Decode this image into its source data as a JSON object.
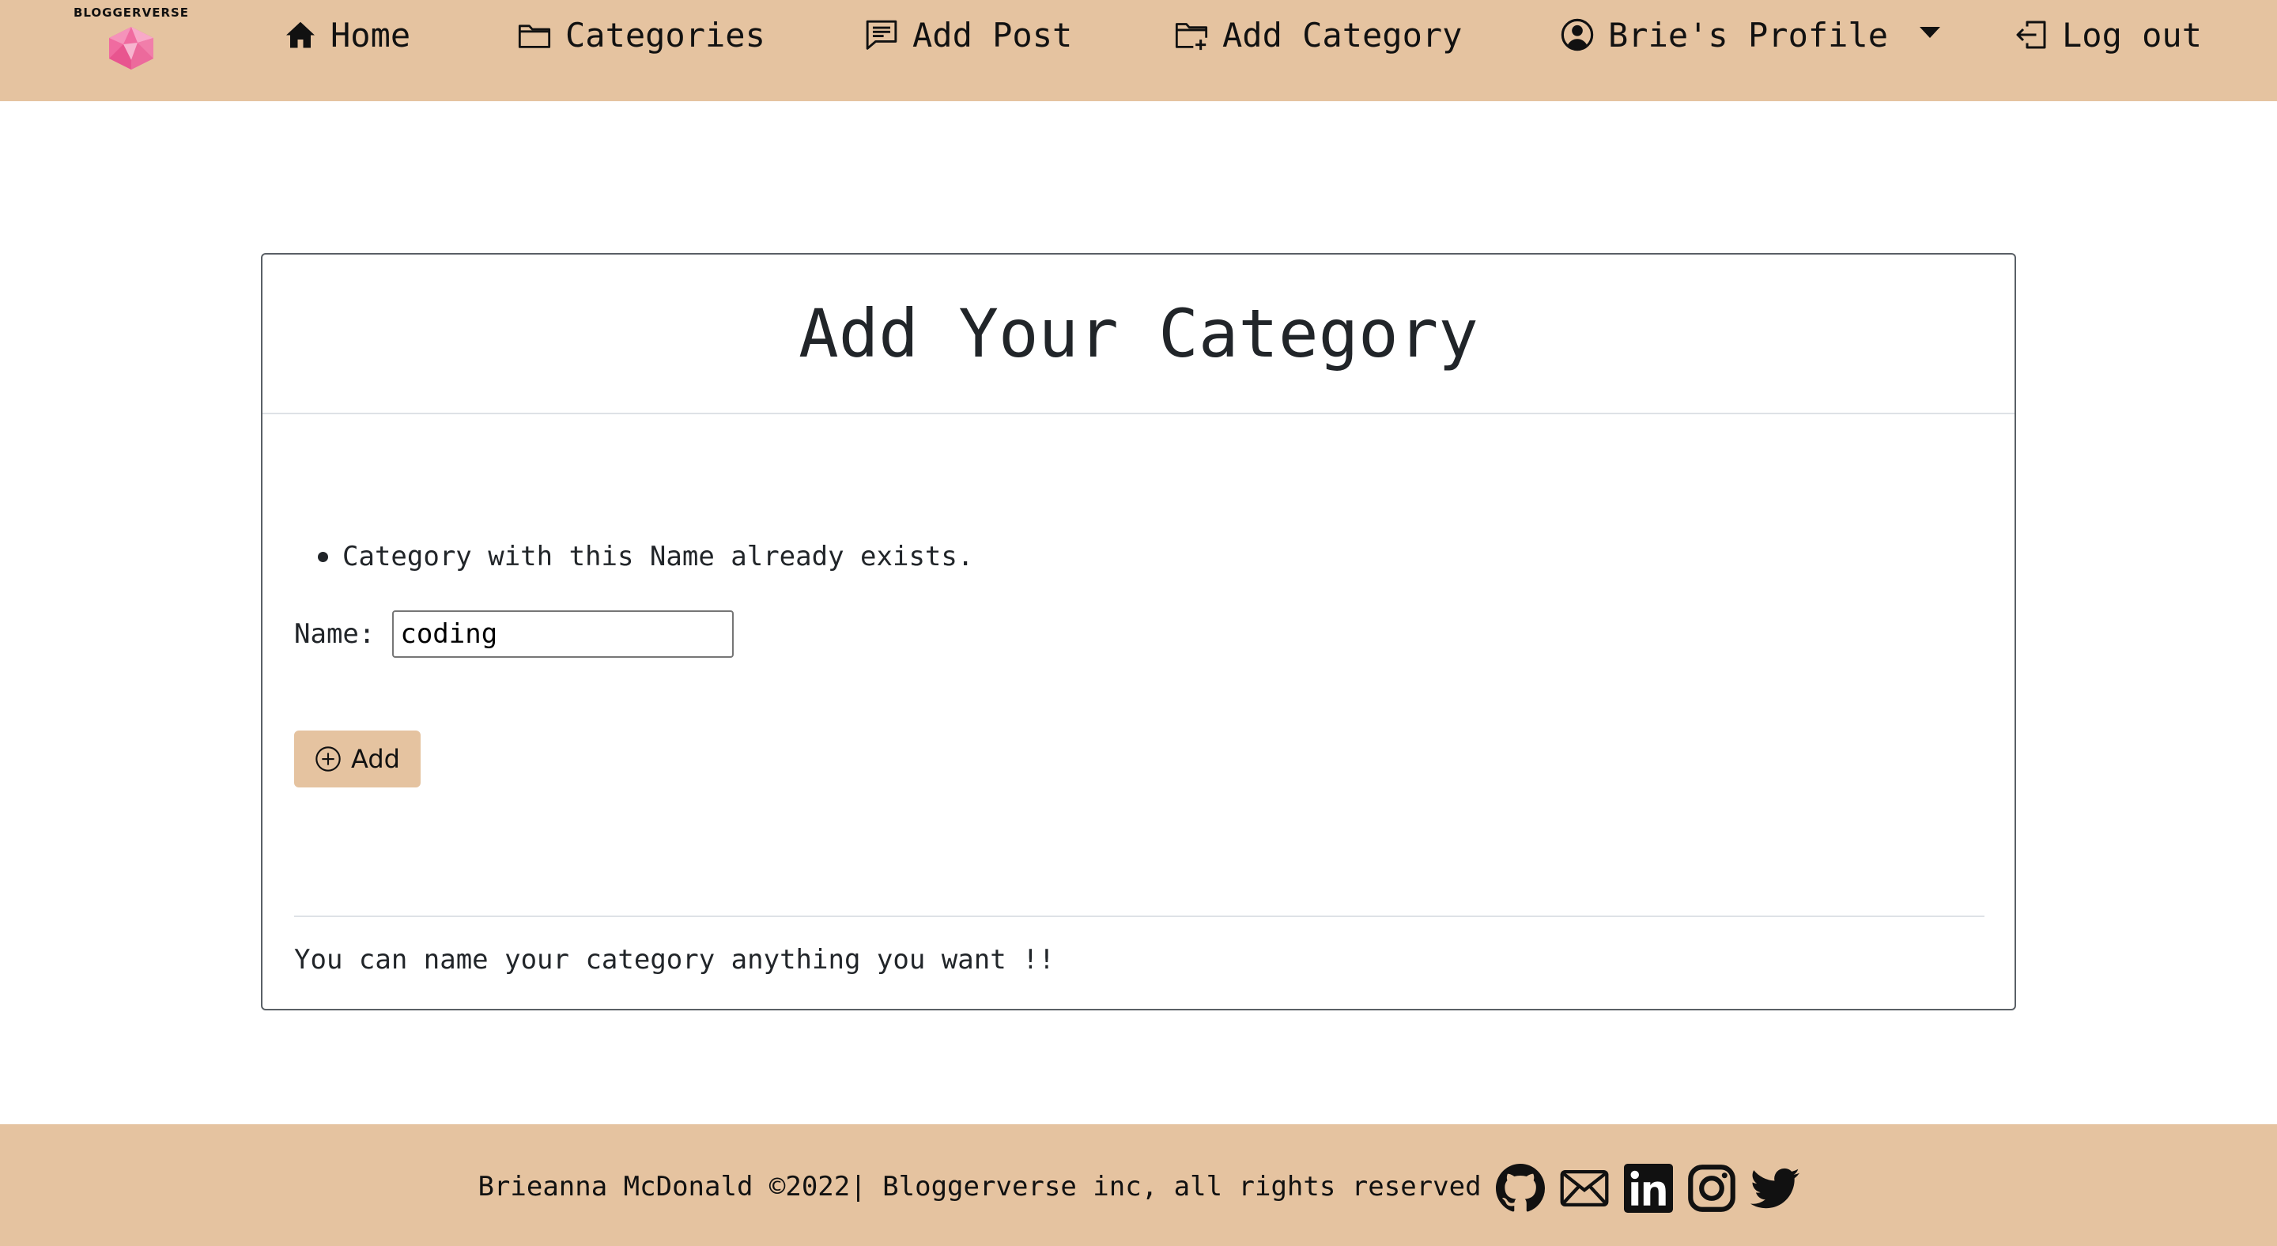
{
  "brand": {
    "name": "BLOGGERVERSE"
  },
  "nav": {
    "home": {
      "label": "Home",
      "icon": "home-icon"
    },
    "categories": {
      "label": "Categories",
      "icon": "folder-icon"
    },
    "add_post": {
      "label": "Add Post",
      "icon": "chat-icon"
    },
    "add_category": {
      "label": "Add Category",
      "icon": "folder-plus-icon"
    },
    "profile": {
      "label": "Brie's Profile",
      "icon": "user-circle-icon"
    },
    "logout": {
      "label": "Log out",
      "icon": "logout-icon"
    }
  },
  "card": {
    "title": "Add Your Category",
    "errors": [
      "Category with this Name already exists."
    ],
    "form": {
      "name_label": "Name:",
      "name_value": "coding"
    },
    "add_button": {
      "label": "Add",
      "icon": "plus-circle-icon"
    },
    "note": "You can name your category anything you want !!"
  },
  "footer": {
    "text": "Brieanna McDonald ©2022| Bloggerverse inc, all rights reserved",
    "social": [
      "github-icon",
      "mail-icon",
      "linkedin-icon",
      "instagram-icon",
      "twitter-icon"
    ]
  },
  "colors": {
    "nav_background": "#e5c3a0",
    "footer_background": "#e5c3a0",
    "button_background": "#e5c3a0",
    "logo_gem": "#f06ba0",
    "text": "#212529"
  }
}
